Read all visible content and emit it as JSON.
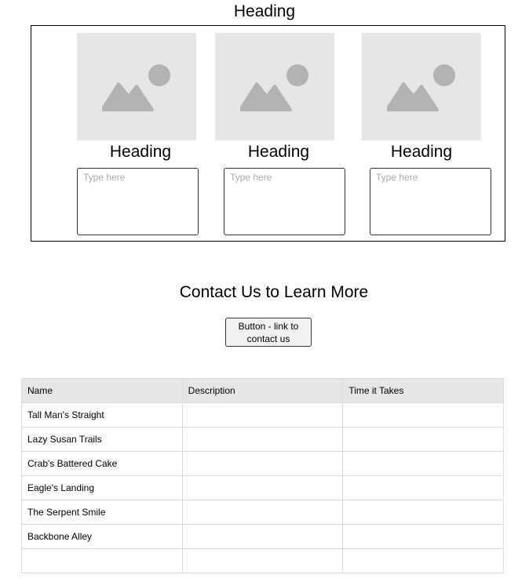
{
  "top_heading": "Heading",
  "cards": [
    {
      "heading": "Heading",
      "placeholder": "Type here",
      "image_icon": "image-placeholder-icon"
    },
    {
      "heading": "Heading",
      "placeholder": "Type here",
      "image_icon": "image-placeholder-icon"
    },
    {
      "heading": "Heading",
      "placeholder": "Type here",
      "image_icon": "image-placeholder-icon"
    }
  ],
  "contact": {
    "title": "Contact Us to Learn More",
    "button_label": "Button - link to contact us"
  },
  "table": {
    "headers": [
      "Name",
      "Description",
      "Time it Takes"
    ],
    "rows": [
      [
        "Tall Man's Straight",
        "",
        ""
      ],
      [
        "Lazy Susan Trails",
        "",
        ""
      ],
      [
        "Crab's Battered Cake",
        "",
        ""
      ],
      [
        "Eagle's Landing",
        "",
        ""
      ],
      [
        "The Serpent Smile",
        "",
        ""
      ],
      [
        "Backbone Alley",
        "",
        ""
      ],
      [
        "",
        "",
        ""
      ]
    ]
  },
  "colors": {
    "placeholder_bg": "#e6e6e6",
    "placeholder_shape": "#b3b3b3",
    "table_header_bg": "#e6e6e6",
    "button_bg": "#f2f2f2"
  }
}
